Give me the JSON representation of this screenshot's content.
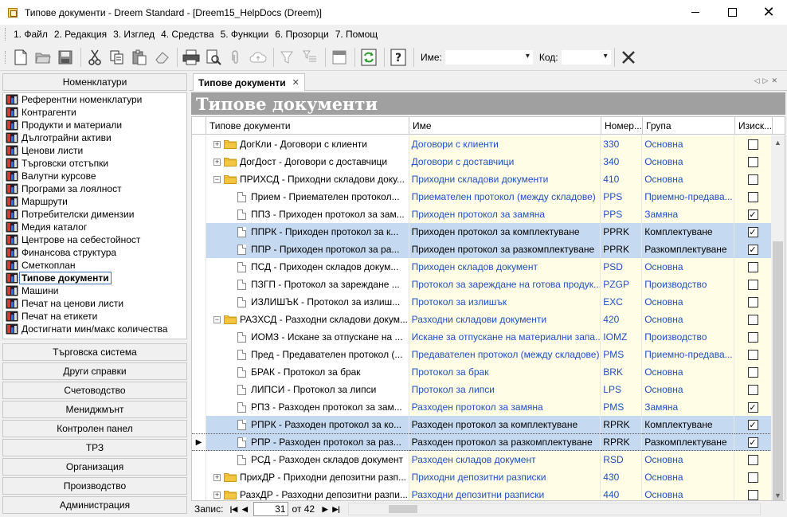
{
  "window": {
    "title": "Типове документи - Dreem Standard - [Dreem15_HelpDocs (Dreem)]"
  },
  "menu": [
    "1. Файл",
    "2. Редакция",
    "3. Изглед",
    "4. Средства",
    "5. Функции",
    "6. Прозорци",
    "7. Помощ"
  ],
  "toolbar": {
    "name_label": "Име:",
    "name_value": "",
    "code_label": "Код:",
    "code_value": ""
  },
  "left": {
    "header": "Номенклатури",
    "items": [
      "Референтни номенклатури",
      "Контрагенти",
      "Продукти и материали",
      "Дълготрайни активи",
      "Ценови листи",
      "Търговски отстъпки",
      "Валутни курсове",
      "Програми за лоялност",
      "Маршрути",
      "Потребителски димензии",
      "Медия каталог",
      "Центрове на себестойност",
      "Финансова структура",
      "Сметкоплан",
      "Типове документи",
      "Машини",
      "Печат на ценови листи",
      "Печат на етикети",
      "Достигнати мин/макс количества"
    ],
    "selected_index": 14,
    "sections": [
      "Търговска система",
      "Други справки",
      "Счетоводство",
      "Мениджмънт",
      "Контролен панел",
      "ТРЗ",
      "Организация",
      "Производство",
      "Администрация"
    ]
  },
  "tab": {
    "label": "Типове документи"
  },
  "banner": "Типове документи",
  "grid": {
    "columns": [
      "Типове документи",
      "Име",
      "Номер...",
      "Група",
      "Изиск..."
    ],
    "rows": [
      {
        "level": 0,
        "kind": "folder",
        "expander": "+",
        "type": "ДогКли - Договори с клиенти",
        "name": "Договори с клиенти",
        "num": "330",
        "group": "Основна",
        "req": false
      },
      {
        "level": 0,
        "kind": "folder",
        "expander": "+",
        "type": "ДогДост - Договори с доставчици",
        "name": "Договори с доставчици",
        "num": "340",
        "group": "Основна",
        "req": false
      },
      {
        "level": 0,
        "kind": "folder",
        "expander": "−",
        "type": "ПРИХСД - Приходни складови доку...",
        "name": "Приходни складови документи",
        "num": "410",
        "group": "Основна",
        "req": false
      },
      {
        "level": 1,
        "kind": "doc",
        "type": "Прием - Приемателен протокол...",
        "name": "Приемателен протокол (между складове)",
        "num": "PPS",
        "group": "Приемно-предава...",
        "req": false
      },
      {
        "level": 1,
        "kind": "doc",
        "type": "ППЗ - Приходен протокол за зам...",
        "name": "Приходен протокол за замяна",
        "num": "PPS",
        "group": "Замяна",
        "req": true
      },
      {
        "level": 1,
        "kind": "doc",
        "type": "ППРК - Приходен протокол за к...",
        "name": "Приходен протокол за комплектуване",
        "num": "PPRK",
        "group": "Комплектуване",
        "req": true,
        "selected": true
      },
      {
        "level": 1,
        "kind": "doc",
        "type": "ППР - Приходен протокол за ра...",
        "name": "Приходен протокол за разкомплектуване",
        "num": "PPRK",
        "group": "Разкомплектуване",
        "req": true,
        "selected": true
      },
      {
        "level": 1,
        "kind": "doc",
        "type": "ПСД - Приходен складов докум...",
        "name": "Приходен складов документ",
        "num": "PSD",
        "group": "Основна",
        "req": false
      },
      {
        "level": 1,
        "kind": "doc",
        "type": "ПЗГП - Протокол за зареждане ...",
        "name": "Протокол за зареждане на готова продук...",
        "num": "PZGP",
        "group": "Производство",
        "req": false
      },
      {
        "level": 1,
        "kind": "doc",
        "type": "ИЗЛИШЪК - Протокол за излиш...",
        "name": "Протокол за излишък",
        "num": "EXC",
        "group": "Основна",
        "req": false
      },
      {
        "level": 0,
        "kind": "folder",
        "expander": "−",
        "type": "РАЗХСД - Разходни складови докум...",
        "name": "Разходни складови документи",
        "num": "420",
        "group": "Основна",
        "req": false
      },
      {
        "level": 1,
        "kind": "doc",
        "type": "ИОМЗ - Искане за отпускане на ...",
        "name": "Искане за отпускане на материални запа...",
        "num": "IOMZ",
        "group": "Производство",
        "req": false
      },
      {
        "level": 1,
        "kind": "doc",
        "type": "Пред - Предавателен протокол (...",
        "name": "Предавателен протокол (между складове)",
        "num": "PMS",
        "group": "Приемно-предава...",
        "req": false
      },
      {
        "level": 1,
        "kind": "doc",
        "type": "БРАК - Протокол за брак",
        "name": "Протокол за брак",
        "num": "BRK",
        "group": "Основна",
        "req": false
      },
      {
        "level": 1,
        "kind": "doc",
        "type": "ЛИПСИ - Протокол за липси",
        "name": "Протокол за липси",
        "num": "LPS",
        "group": "Основна",
        "req": false
      },
      {
        "level": 1,
        "kind": "doc",
        "type": "РПЗ - Разходен протокол за зам...",
        "name": "Разходен протокол за замяна",
        "num": "PMS",
        "group": "Замяна",
        "req": true
      },
      {
        "level": 1,
        "kind": "doc",
        "type": "РПРК - Разходен протокол за ко...",
        "name": "Разходен протокол за комплектуване",
        "num": "RPRK",
        "group": "Комплектуване",
        "req": true,
        "selected": true
      },
      {
        "level": 1,
        "kind": "doc",
        "type": "РПР - Разходен протокол за раз...",
        "name": "Разходен протокол за разкомплектуване",
        "num": "RPRK",
        "group": "Разкомплектуване",
        "req": true,
        "selected": true,
        "current": true
      },
      {
        "level": 1,
        "kind": "doc",
        "type": "РСД - Разходен складов документ",
        "name": "Разходен складов документ",
        "num": "RSD",
        "group": "Основна",
        "req": false
      },
      {
        "level": 0,
        "kind": "folder",
        "expander": "+",
        "type": "ПрихДР - Приходни депозитни разп...",
        "name": "Приходни депозитни разписки",
        "num": "430",
        "group": "Основна",
        "req": false
      },
      {
        "level": 0,
        "kind": "folder",
        "expander": "+",
        "type": "РазхДР - Разходни депозитни разпи...",
        "name": "Разходни депозитни разписки",
        "num": "440",
        "group": "Основна",
        "req": false
      }
    ]
  },
  "navigator": {
    "label": "Запис:",
    "current": "31",
    "total_label": "от 42"
  }
}
